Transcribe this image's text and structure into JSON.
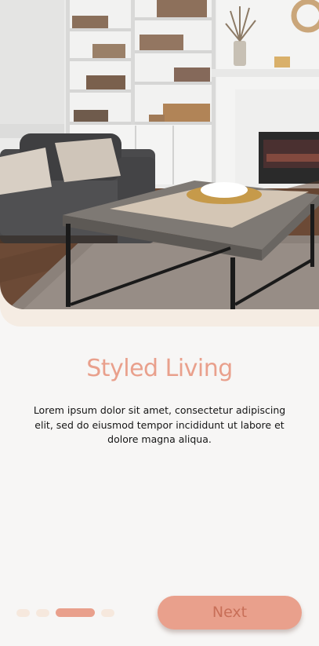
{
  "onboarding": {
    "title": "Styled Living",
    "description": "Lorem ipsum dolor sit amet, consectetur adipiscing elit, sed do eiusmod tempor incididunt ut labore et dolore magna aliqua.",
    "next_label": "Next",
    "page_count": 4,
    "active_page": 3
  },
  "colors": {
    "accent": "#e9a08c",
    "accent_text": "#c86f58",
    "dot_inactive": "#f6e8dd",
    "hero_band": "#f5ece3",
    "background": "#f7f6f5",
    "body_text": "#151515"
  },
  "hero_image": {
    "subject": "living room with grey sofa, coffee table, bookshelves and fireplace",
    "icon": "photo"
  }
}
